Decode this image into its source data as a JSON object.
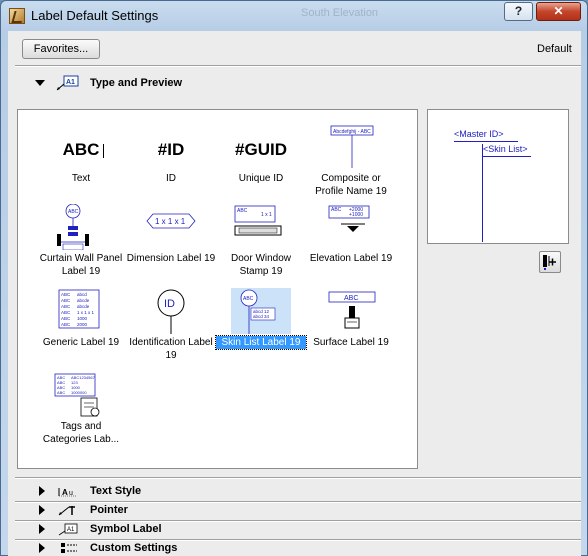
{
  "window": {
    "title": "Label Default Settings",
    "ghost_title": "South Elevation",
    "help_label": "?",
    "close_label": "✕"
  },
  "header": {
    "favorites_label": "Favorites...",
    "default_label": "Default"
  },
  "sections": [
    {
      "title": "Type and Preview",
      "expanded": true,
      "icon": "label-type-icon"
    },
    {
      "title": "Text Style",
      "expanded": false,
      "icon": "text-style-icon"
    },
    {
      "title": "Pointer",
      "expanded": false,
      "icon": "pointer-icon"
    },
    {
      "title": "Symbol Label",
      "expanded": false,
      "icon": "symbol-label-icon"
    },
    {
      "title": "Custom Settings",
      "expanded": false,
      "icon": "custom-settings-icon"
    }
  ],
  "label_types": [
    {
      "name": "Text",
      "preview": "ABC"
    },
    {
      "name": "ID",
      "preview": "#ID"
    },
    {
      "name": "Unique ID",
      "preview": "#GUID"
    },
    {
      "name": "Composite or Profile Name 19",
      "preview": "Abcdefghij - ABC"
    },
    {
      "name": "Curtain Wall Panel Label 19",
      "preview": "ABC"
    },
    {
      "name": "Dimension Label 19",
      "preview": "1 x 1 x 1"
    },
    {
      "name": "Door Window Stamp 19",
      "preview": "ABC"
    },
    {
      "name": "Elevation Label 19",
      "preview": "ABC"
    },
    {
      "name": "Generic Label 19",
      "preview": "ABC"
    },
    {
      "name": "Identification Label 19",
      "preview": "ID"
    },
    {
      "name": "Skin List Label 19",
      "preview": "ABC",
      "selected": true
    },
    {
      "name": "Surface Label 19",
      "preview": "ABC"
    },
    {
      "name": "Tags and Categories Lab...",
      "preview": "ABC"
    }
  ],
  "preview": {
    "master_id": "<Master ID>",
    "skin_list": "<Skin List>"
  },
  "colors": {
    "accent_blue": "#2020c0",
    "selection": "#3399ff"
  }
}
